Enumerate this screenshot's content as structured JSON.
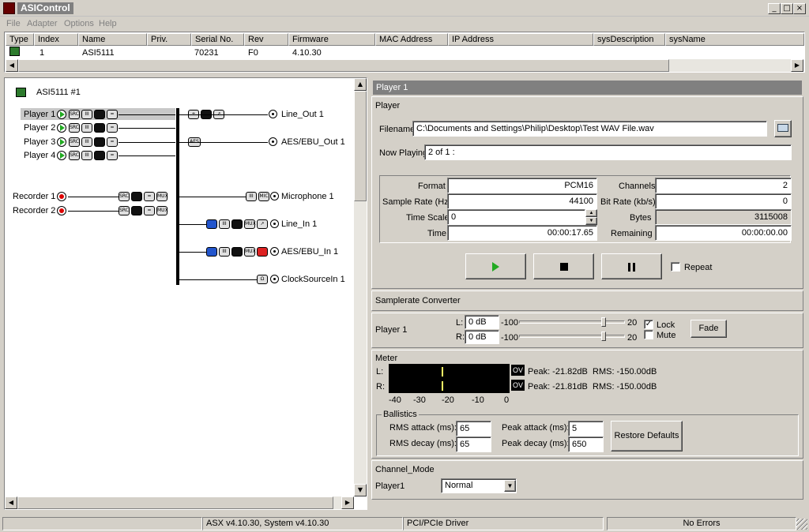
{
  "window": {
    "title": "ASIControl",
    "min": "_",
    "max": "□",
    "close": "×"
  },
  "menu": [
    "File",
    "Adapter",
    "Options",
    "Help"
  ],
  "list": {
    "headers": [
      "Type",
      "Index",
      "Name",
      "Priv.",
      "Serial No.",
      "Rev",
      "Firmware",
      "MAC Address",
      "IP Address",
      "sysDescription",
      "sysName"
    ],
    "row": {
      "index": "1",
      "name": "ASI5111",
      "serial": "70231",
      "rev": "F0",
      "firmware": "4.10.30"
    }
  },
  "tree": {
    "adapter": "ASI5111 #1",
    "players": [
      "Player  1",
      "Player  2",
      "Player  3",
      "Player  4"
    ],
    "recorders": [
      "Recorder  1",
      "Recorder  2"
    ],
    "outputs": [
      "Line_Out  1",
      "AES/EBU_Out  1"
    ],
    "inputs": [
      "Microphone  1",
      "Line_In  1",
      "AES/EBU_In  1",
      "ClockSourceIn  1"
    ]
  },
  "panel": {
    "header": "Player  1",
    "player_section": "Player",
    "filename_label": "Filename",
    "filename": "C:\\Documents and Settings\\Philip\\Desktop\\Test WAV File.wav",
    "now_playing_label": "Now Playing",
    "now_playing": "2 of 1 :",
    "format_label": "Format",
    "format": "PCM16",
    "channels_label": "Channels",
    "channels": "2",
    "samplerate_label": "Sample Rate (Hz)",
    "samplerate": "44100",
    "bitrate_label": "Bit Rate (kb/s)",
    "bitrate": "0",
    "timescale_label": "Time Scale",
    "timescale": "0",
    "bytes_label": "Bytes",
    "bytes": "3115008",
    "time_label": "Time",
    "time": "00:00:17.65",
    "remaining_label": "Remaining",
    "remaining": "00:00:00.00",
    "repeat_label": "Repeat",
    "src_section": "Samplerate Converter",
    "vol_player": "Player  1",
    "l_label": "L:",
    "l_db": "0 dB",
    "r_label": "R:",
    "r_db": "0 dB",
    "slider_min": "-100",
    "slider_max": "20",
    "lock_label": "Lock",
    "mute_label": "Mute",
    "fade_label": "Fade",
    "meter_section": "Meter",
    "meter_l": "L:",
    "meter_r": "R:",
    "ov": "OV",
    "peak_l": "Peak: -21.82dB",
    "rms_l": "RMS: -150.00dB",
    "peak_r": "Peak: -21.81dB",
    "rms_r": "RMS: -150.00dB",
    "scale": [
      "-40",
      "-30",
      "-20",
      "-10",
      "0"
    ],
    "ballistics": "Ballistics",
    "rms_attack_label": "RMS attack (ms):",
    "rms_attack": "65",
    "rms_decay_label": "RMS decay (ms):",
    "rms_decay": "65",
    "peak_attack_label": "Peak attack (ms):",
    "peak_attack": "5",
    "peak_decay_label": "Peak decay (ms):",
    "peak_decay": "650",
    "restore_label": "Restore Defaults",
    "channel_mode_section": "Channel_Mode",
    "channel_player": "Player1",
    "channel_mode": "Normal"
  },
  "status": {
    "version": "ASX v4.10.30, System v4.10.30",
    "driver": "PCI/PCIe Driver",
    "errors": "No Errors"
  },
  "colors": {
    "accent_play": "#22aa22",
    "record": "#dd0000",
    "meter_bg": "#000000",
    "meter_peak": "#ffff66"
  }
}
